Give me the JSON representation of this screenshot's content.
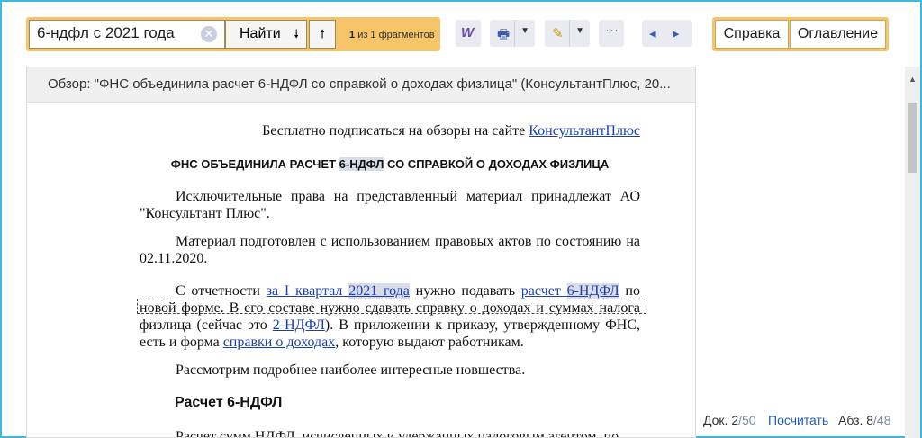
{
  "search": {
    "value": "6-ндфл с 2021 года",
    "find_label": "Найти",
    "found_count": "1",
    "found_text": "из 1 фрагментов"
  },
  "toolbar": {
    "icons": [
      "word-export-icon",
      "print-icon",
      "highlighter-icon",
      "more-icon",
      "back-icon",
      "forward-icon"
    ]
  },
  "right_buttons": {
    "help": "Справка",
    "toc": "Оглавление"
  },
  "document": {
    "header": "Обзор: \"ФНС объединила расчет 6-НДФЛ со справкой о доходах физлица\" (КонсультантПлюс, 20...",
    "subscribe_text": "Бесплатно подписаться на обзоры на сайте ",
    "subscribe_link": "КонсультантПлюс",
    "title_pre": "ФНС ОБЪЕДИНИЛА РАСЧЕТ ",
    "title_hl": "6-НДФЛ",
    "title_post": " СО СПРАВКОЙ О ДОХОДАХ ФИЗЛИЦА",
    "rights": "Исключительные права на представленный материал принадлежат АО \"Консультант Плюс\".",
    "prepared": "Материал подготовлен с использованием правовых актов по состоянию на 02.11.2020.",
    "p3_a": "С отчетности ",
    "p3_link1_a": "за I квартал ",
    "p3_link1_hl": "2021 года",
    "p3_b": " нужно подавать ",
    "p3_link2_a": "расчет ",
    "p3_link2_hl": "6-НДФЛ",
    "p3_c": " по новой форме. В его составе нужно сдавать справку о доходах и суммах налога физлица (сейчас это ",
    "p3_link3": "2-НДФЛ",
    "p3_d": "). В приложении к приказу, утвержденному ФНС, есть и форма ",
    "p3_link4": "справки о доходах",
    "p3_e": ", которую выдают работникам.",
    "p4": "Рассмотрим подробнее наиболее интересные новшества.",
    "section_title": "Расчет 6-НДФЛ",
    "p5": "Расчет сумм НДФЛ, исчисленных и удержанных налоговым агентом, по"
  },
  "status": {
    "doc_label": "Док. 2",
    "doc_total": "/50",
    "calc_link": "Посчитать",
    "para_label": "Абз. 8",
    "para_total": "/48"
  },
  "colors": {
    "accent": "#f6c56a",
    "frame": "#3fb8e0",
    "link": "#1a3fb0"
  }
}
